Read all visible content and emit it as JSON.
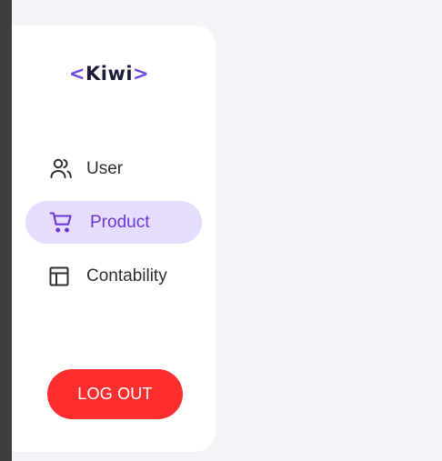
{
  "brand": {
    "open_bracket": "<",
    "name": "Kiwi",
    "close_bracket": ">",
    "accent_color": "#6d46e6",
    "text_color": "#1b1b3a"
  },
  "sidebar": {
    "items": [
      {
        "label": "User",
        "icon": "users-icon",
        "active": false
      },
      {
        "label": "Product",
        "icon": "cart-icon",
        "active": true
      },
      {
        "label": "Contability",
        "icon": "table-icon",
        "active": false
      }
    ],
    "active_background": "#e6dcfd",
    "active_color": "#6a37d6"
  },
  "actions": {
    "logout_label": "LOG OUT",
    "logout_color": "#ff2e2e"
  }
}
